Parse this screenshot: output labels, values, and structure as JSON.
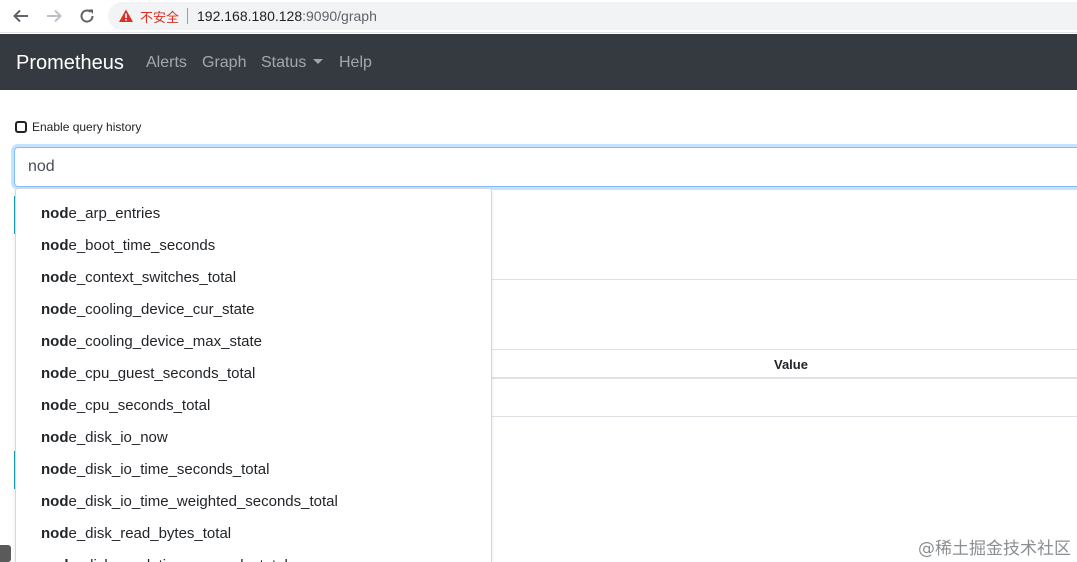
{
  "browser": {
    "insecure_label": "不安全",
    "url_host": "192.168.180.128",
    "url_rest": ":9090/graph"
  },
  "navbar": {
    "brand": "Prometheus",
    "links": [
      "Alerts",
      "Graph",
      "Status",
      "Help"
    ]
  },
  "query_history": {
    "label": "Enable query history"
  },
  "expression_input": {
    "value": "nod"
  },
  "table": {
    "value_header": "Value"
  },
  "autocomplete": {
    "prefix": "nod",
    "items": [
      "e_arp_entries",
      "e_boot_time_seconds",
      "e_context_switches_total",
      "e_cooling_device_cur_state",
      "e_cooling_device_max_state",
      "e_cpu_guest_seconds_total",
      "e_cpu_seconds_total",
      "e_disk_io_now",
      "e_disk_io_time_seconds_total",
      "e_disk_io_time_weighted_seconds_total",
      "e_disk_read_bytes_total",
      "e_disk_read_time_seconds_total"
    ]
  },
  "watermark": "@稀土掘金技术社区",
  "colors": {
    "navbar_bg": "#343a40",
    "warning": "#d93025",
    "focus_border": "#80bdff",
    "tab_accent": "#17a2b8"
  }
}
